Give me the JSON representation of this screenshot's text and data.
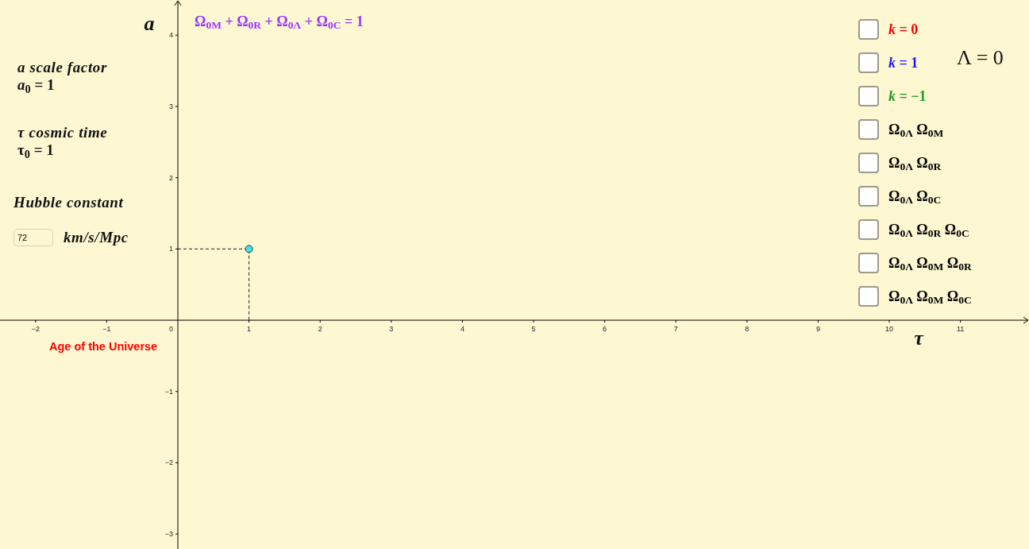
{
  "graph": {
    "chart_data": {
      "type": "scatter",
      "xlabel": "τ",
      "ylabel": "a",
      "xlim": [
        -2.5,
        11.964
      ],
      "ylim": [
        -3.21,
        4.493
      ],
      "xticks": [
        {
          "value": -2,
          "label": "−2"
        },
        {
          "value": -1,
          "label": "−1"
        },
        1,
        2,
        3,
        4,
        5,
        6,
        7,
        8,
        9,
        10,
        11
      ],
      "yticks": [
        {
          "value": -3,
          "label": "−3"
        },
        {
          "value": -2,
          "label": "−2"
        },
        {
          "value": -1,
          "label": "−1"
        },
        1,
        2,
        3,
        4
      ],
      "x": [
        1
      ],
      "series": [
        {
          "color": "#3ee6e6",
          "values": [
            1
          ]
        }
      ]
    },
    "origin_label": "0"
  },
  "formula": "Ω$_{0M}$ + Ω$_{0R}$ + Ω$_{0Λ}$ + Ω$_{0C}$ = 1",
  "left_panel": {
    "scale_factor_title": "a scale factor",
    "scale_factor_value": "*a*$_{0}$ = 1",
    "time_title": "τ cosmic time",
    "time_value": "τ$_{0}$ = 1",
    "hubble_title": "Hubble constant",
    "hubble_field": {
      "value": "72"
    },
    "hubble_unit": "km/s/Mpc",
    "age_label": "Age of the Universe"
  },
  "checkboxes": [
    {
      "label": "*k* = 0",
      "color": "#ff0000",
      "checked": false
    },
    {
      "label": "*k* = 1",
      "color": "#1a1aff",
      "checked": false
    },
    {
      "label": "*k* = −1",
      "color": "#1f9a1f",
      "checked": false
    },
    {
      "label": "Ω$_{0Λ}$ Ω$_{0M}$",
      "color": "#000000",
      "checked": false
    },
    {
      "label": "Ω$_{0Λ}$ Ω$_{0R}$",
      "color": "#000000",
      "checked": false
    },
    {
      "label": "Ω$_{0Λ}$ Ω$_{0C}$",
      "color": "#000000",
      "checked": false
    },
    {
      "label": "Ω$_{0Λ}$ Ω$_{0R}$ Ω$_{0C}$",
      "color": "#000000",
      "checked": false
    },
    {
      "label": "Ω$_{0Λ}$ Ω$_{0M}$ Ω$_{0R}$",
      "color": "#000000",
      "checked": false
    },
    {
      "label": "Ω$_{0Λ}$ Ω$_{0M}$ Ω$_{0C}$",
      "color": "#000000",
      "checked": false
    }
  ],
  "lambda_note": "Λ = 0"
}
